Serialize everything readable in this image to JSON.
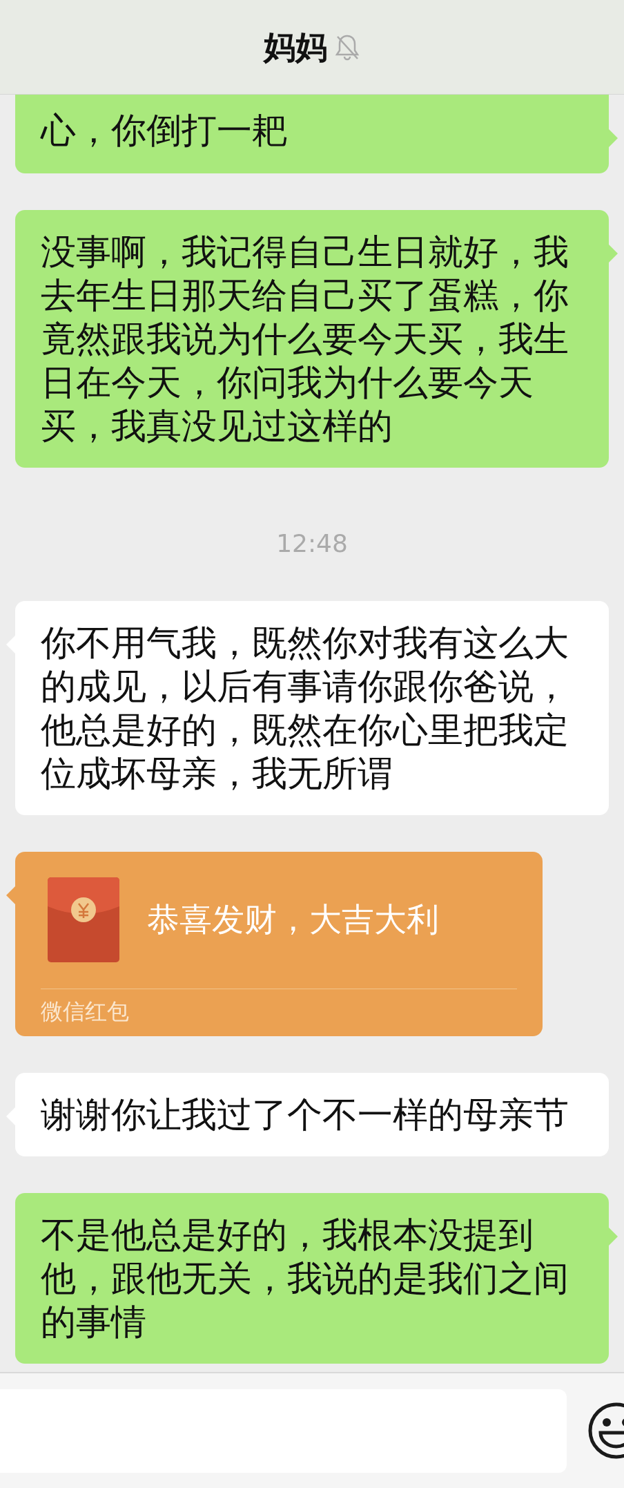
{
  "header": {
    "title": "妈妈",
    "muted": true
  },
  "messages": [
    {
      "kind": "text",
      "outgoing": true,
      "text": "心，你倒打一耙",
      "cut_top": true
    },
    {
      "kind": "text",
      "outgoing": true,
      "text": "没事啊，我记得自己生日就好，我去年生日那天给自己买了蛋糕，你竟然跟我说为什么要今天买，我生日在今天，你问我为什么要今天买，我真没见过这样的"
    },
    {
      "kind": "time",
      "text": "12:48"
    },
    {
      "kind": "text",
      "outgoing": false,
      "text": "你不用气我，既然你对我有这么大的成见，以后有事请你跟你爸说，他总是好的，既然在你心里把我定位成坏母亲，我无所谓"
    },
    {
      "kind": "red_packet",
      "outgoing": false,
      "greeting": "恭喜发财，大吉大利",
      "label": "微信红包"
    },
    {
      "kind": "text",
      "outgoing": false,
      "text": "谢谢你让我过了个不一样的母亲节"
    },
    {
      "kind": "text",
      "outgoing": true,
      "text": "不是他总是好的，我根本没提到他，跟他无关，我说的是我们之间的事情"
    }
  ]
}
